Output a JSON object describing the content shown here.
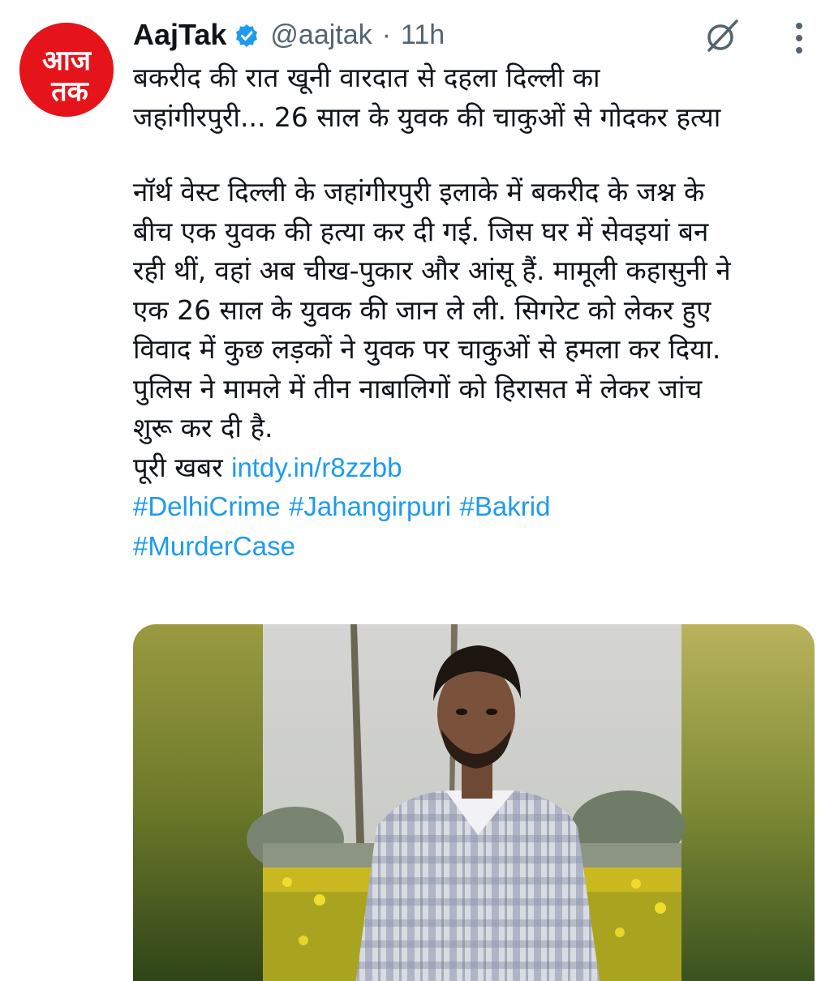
{
  "tweet": {
    "display_name": "AajTak",
    "handle": "@aajtak",
    "separator": "·",
    "time": "11h",
    "headline": [
      "बकरीद की रात खूनी वारदात से दहला दिल्ली का",
      "जहांगीरपुरी... 26 साल के युवक की चाकुओं से गोदकर हत्या"
    ],
    "body": [
      "नॉर्थ वेस्ट दिल्ली के जहांगीरपुरी इलाके में बकरीद के जश्न के",
      "बीच एक युवक की हत्या कर दी गई. जिस घर में सेवइयां बन",
      "रही थीं, वहां अब चीख-पुकार और आंसू हैं. मामूली कहासुनी ने",
      "एक 26 साल के युवक की जान ले ली. सिगरेट को लेकर हुए",
      "विवाद में कुछ लड़कों ने युवक पर चाकुओं से हमला कर दिया.",
      "पुलिस ने मामले में तीन नाबालिगों को हिरासत में लेकर जांच",
      "शुरू कर दी है."
    ],
    "more_label": "पूरी खबर",
    "link": "intdy.in/r8zzbb",
    "hashtags": [
      "#DelhiCrime",
      "#Jahangirpuri",
      "#Bakrid",
      "#MurderCase"
    ]
  },
  "avatar": {
    "logo_top": "आज",
    "logo_bottom": "तक"
  },
  "icons": {
    "verified": "verified-badge-icon",
    "grok": "grok-icon",
    "more": "more-vertical-icon"
  },
  "colors": {
    "brand_red": "#e5141b",
    "link_blue": "#1d9bf0",
    "secondary_text": "#536471",
    "primary_text": "#0f1419"
  }
}
